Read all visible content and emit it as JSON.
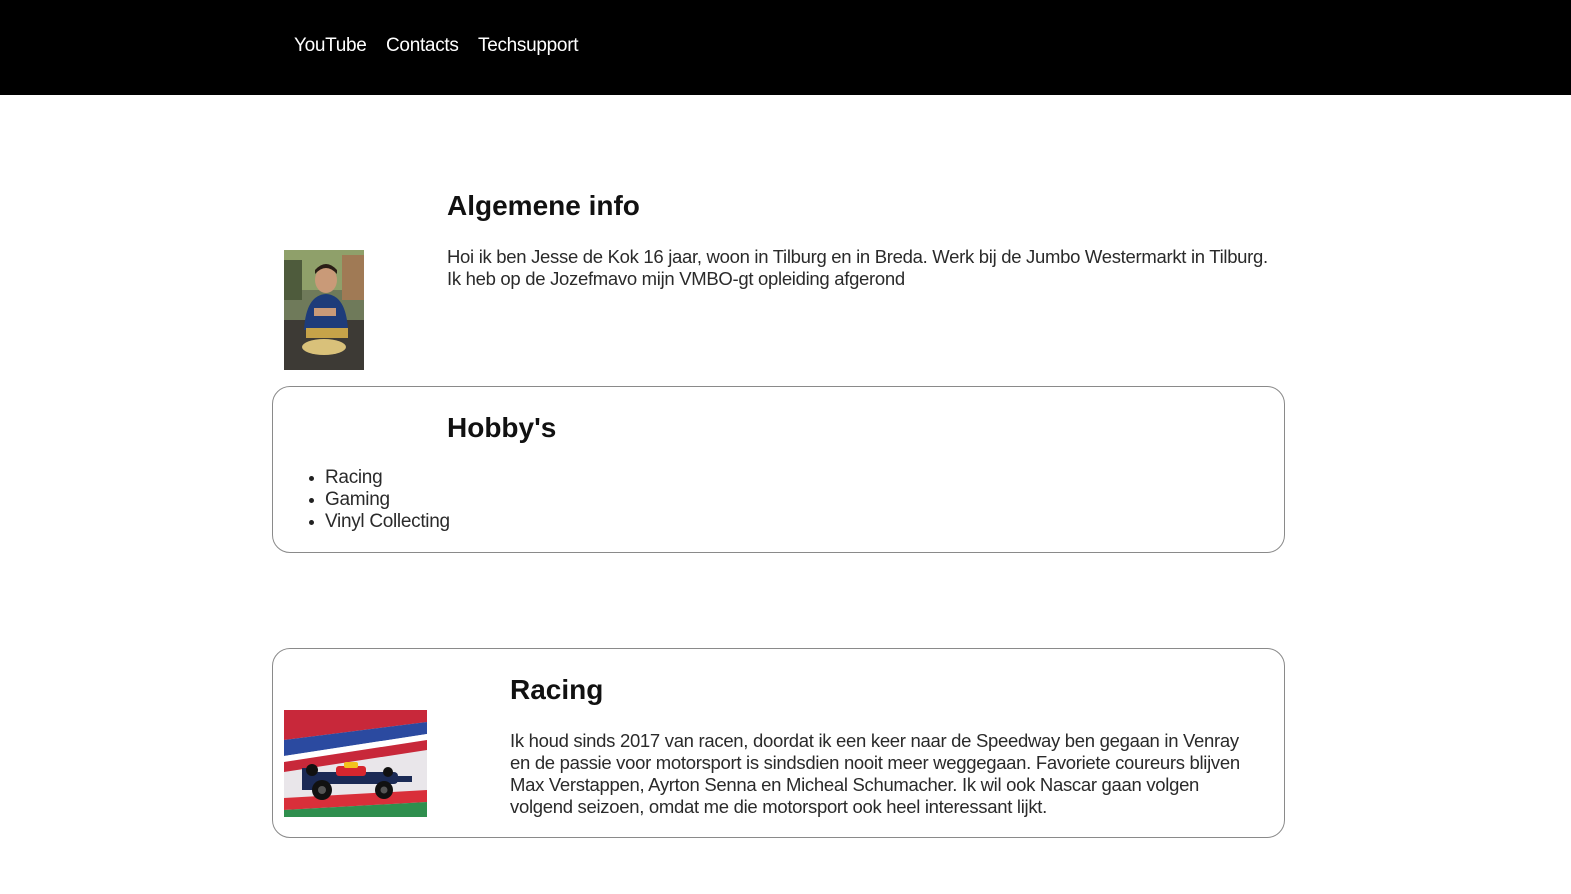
{
  "nav": {
    "items": [
      {
        "label": "YouTube"
      },
      {
        "label": "Contacts"
      },
      {
        "label": "Techsupport"
      }
    ]
  },
  "info": {
    "heading": "Algemene info",
    "text": "Hoi ik ben Jesse de Kok 16 jaar, woon in Tilburg en in Breda. Werk bij de Jumbo Westermarkt in Tilburg. Ik heb op de Jozefmavo mijn VMBO-gt opleiding afgerond"
  },
  "hobbies": {
    "heading": "Hobby's",
    "items": [
      {
        "label": "Racing"
      },
      {
        "label": "Gaming"
      },
      {
        "label": "Vinyl Collecting"
      }
    ]
  },
  "racing": {
    "heading": "Racing",
    "text": "Ik houd sinds 2017 van racen, doordat ik een keer naar de Speedway ben gegaan in Venray en de passie voor motorsport is sindsdien nooit meer weggegaan. Favoriete coureurs blijven Max Verstappen, Ayrton Senna en Micheal Schumacher. Ik wil ook Nascar gaan volgen volgend seizoen, omdat me die motorsport ook heel interessant lijkt."
  }
}
